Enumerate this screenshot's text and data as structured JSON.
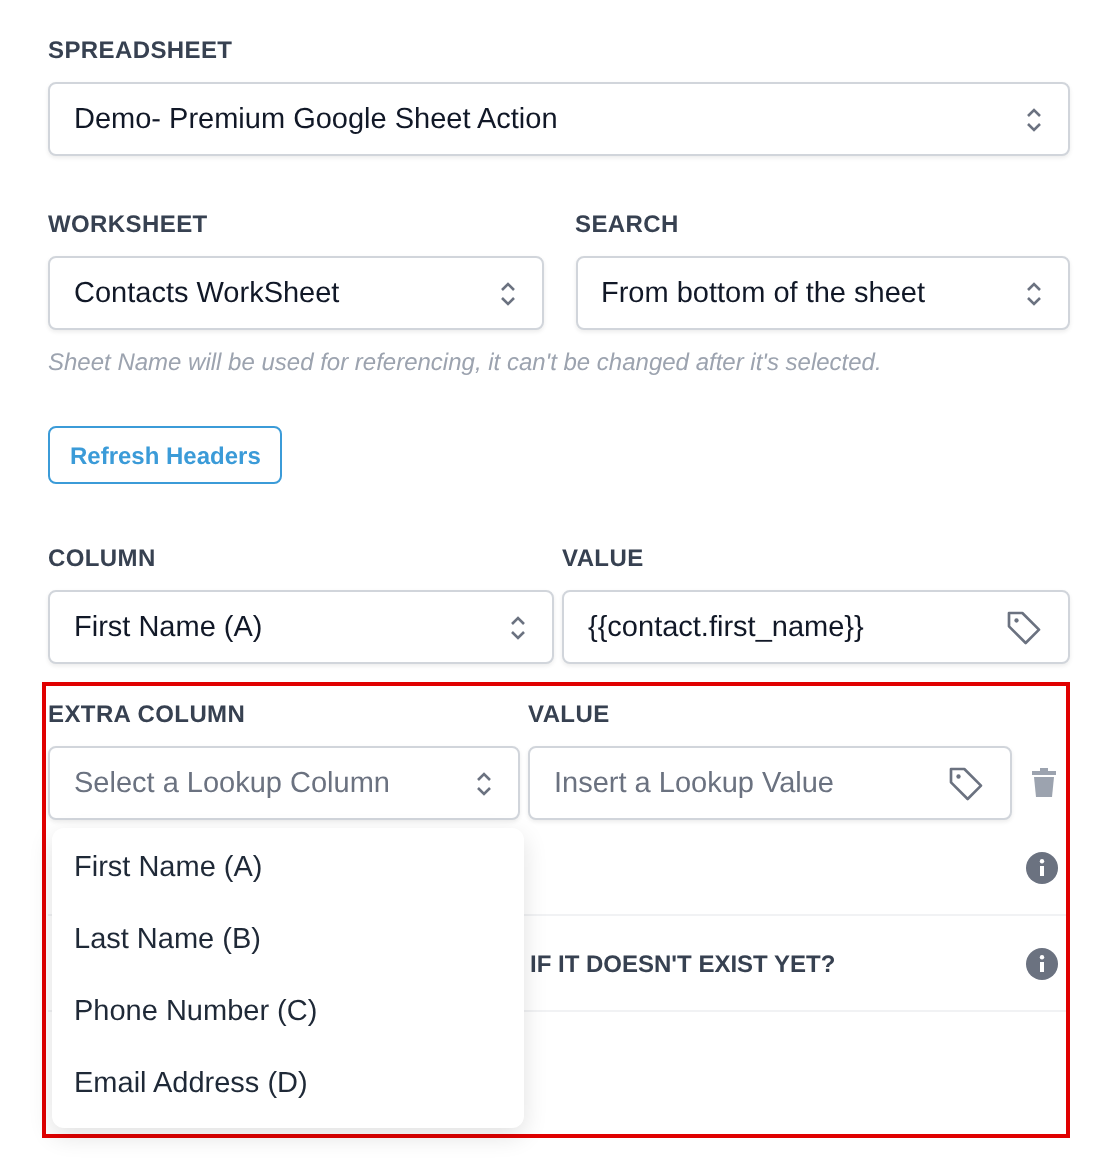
{
  "spreadsheet": {
    "label": "SPREADSHEET",
    "value": "Demo- Premium Google Sheet Action"
  },
  "worksheet": {
    "label": "WORKSHEET",
    "value": "Contacts WorkSheet"
  },
  "search": {
    "label": "SEARCH",
    "value": "From bottom of the sheet"
  },
  "hint": "Sheet Name will be used for referencing, it can't be changed after it's selected.",
  "refresh_button": "Refresh Headers",
  "column": {
    "label": "COLUMN",
    "value": "First Name (A)"
  },
  "value": {
    "label": "VALUE",
    "value": "{{contact.first_name}}"
  },
  "extra_column": {
    "label": "EXTRA COLUMN",
    "placeholder": "Select a Lookup Column",
    "expanded": true,
    "options": [
      {
        "label": "First Name (A)"
      },
      {
        "label": "Last Name (B)"
      },
      {
        "label": "Phone Number (C)"
      },
      {
        "label": "Email Address (D)"
      }
    ]
  },
  "extra_value": {
    "label": "VALUE",
    "placeholder": "Insert a Lookup Value"
  },
  "hidden_rows": [
    {
      "kind": "info"
    },
    {
      "kind": "info",
      "label": "IF IT DOESN'T EXIST YET?"
    }
  ]
}
